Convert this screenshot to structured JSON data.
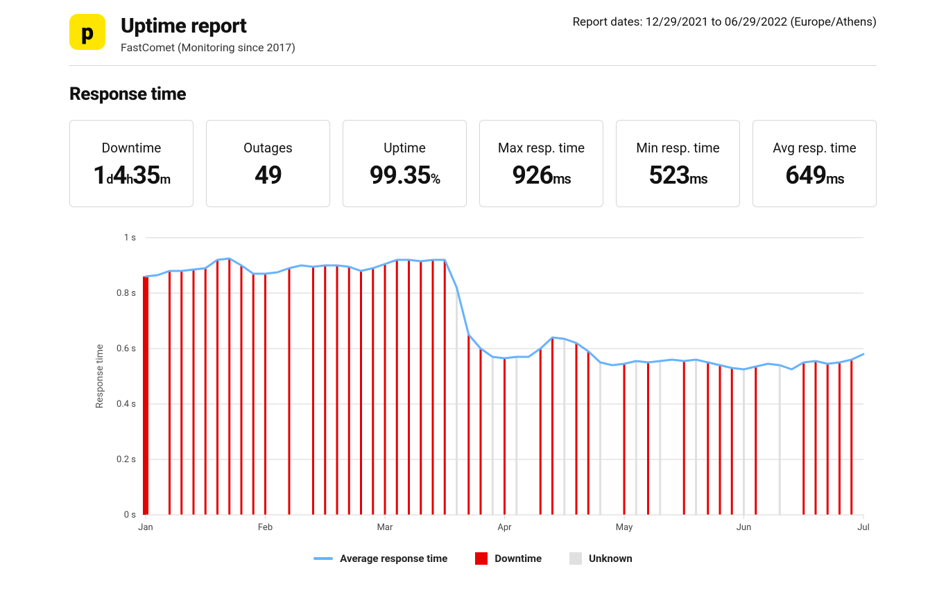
{
  "header": {
    "title": "Uptime report",
    "subtitle": "FastComet (Monitoring since 2017)",
    "logo_letter": "p",
    "report_dates": "Report dates: 12/29/2021 to 06/29/2022 (Europe/Athens)"
  },
  "section_title": "Response time",
  "cards": {
    "downtime": {
      "label": "Downtime",
      "d": "1",
      "h": "4",
      "m": "35"
    },
    "outages": {
      "label": "Outages",
      "value": "49"
    },
    "uptime": {
      "label": "Uptime",
      "value": "99.35",
      "unit": "%"
    },
    "max": {
      "label": "Max resp. time",
      "value": "926",
      "unit": "ms"
    },
    "min": {
      "label": "Min resp. time",
      "value": "523",
      "unit": "ms"
    },
    "avg": {
      "label": "Avg resp. time",
      "value": "649",
      "unit": "ms"
    }
  },
  "legend": {
    "avg": "Average response time",
    "down": "Downtime",
    "unk": "Unknown"
  },
  "colors": {
    "line": "#66b3ff",
    "downtime": "#e60000",
    "unknown": "#e0e0e0",
    "grid": "#d6d6d6",
    "axis": "#444"
  },
  "chart_data": {
    "type": "line",
    "title": "Response time",
    "xlabel": "",
    "ylabel": "Response time",
    "ylim": [
      0,
      1
    ],
    "y_ticks": [
      "0 s",
      "0.2 s",
      "0.4 s",
      "0.6 s",
      "0.8 s",
      "1 s"
    ],
    "x_ticks": [
      "Jan",
      "Feb",
      "Mar",
      "Apr",
      "May",
      "Jun",
      "Jul"
    ],
    "x": [
      0,
      1,
      2,
      3,
      4,
      5,
      6,
      7,
      8,
      9,
      10,
      11,
      12,
      13,
      14,
      15,
      16,
      17,
      18,
      19,
      20,
      21,
      22,
      23,
      24,
      25,
      26,
      27,
      28,
      29,
      30,
      31,
      32,
      33,
      34,
      35,
      36,
      37,
      38,
      39,
      40,
      41,
      42,
      43,
      44,
      45,
      46,
      47,
      48,
      49,
      50,
      51,
      52,
      53,
      54,
      55,
      56,
      57,
      58,
      59,
      60
    ],
    "series": [
      {
        "name": "Average response time",
        "values": [
          0.86,
          0.865,
          0.88,
          0.88,
          0.885,
          0.89,
          0.92,
          0.925,
          0.9,
          0.87,
          0.87,
          0.875,
          0.89,
          0.9,
          0.895,
          0.9,
          0.9,
          0.895,
          0.88,
          0.89,
          0.905,
          0.92,
          0.92,
          0.915,
          0.92,
          0.92,
          0.82,
          0.65,
          0.6,
          0.57,
          0.565,
          0.57,
          0.57,
          0.6,
          0.64,
          0.635,
          0.62,
          0.59,
          0.55,
          0.54,
          0.545,
          0.555,
          0.55,
          0.555,
          0.56,
          0.555,
          0.56,
          0.55,
          0.54,
          0.53,
          0.525,
          0.535,
          0.545,
          0.54,
          0.525,
          0.55,
          0.555,
          0.545,
          0.55,
          0.56,
          0.58
        ]
      }
    ],
    "downtime_x": [
      2,
      3,
      4,
      5,
      6,
      7,
      8,
      9,
      10,
      12,
      14,
      15,
      16,
      17,
      18,
      19,
      20,
      21,
      22,
      23,
      24,
      25,
      27,
      28,
      30,
      33,
      34,
      36,
      37,
      40,
      42,
      45,
      47,
      48,
      49,
      51,
      55,
      56,
      57,
      58,
      59
    ],
    "unknown_x": [
      26,
      29,
      31,
      35,
      38,
      41,
      43,
      46,
      50,
      53
    ]
  }
}
